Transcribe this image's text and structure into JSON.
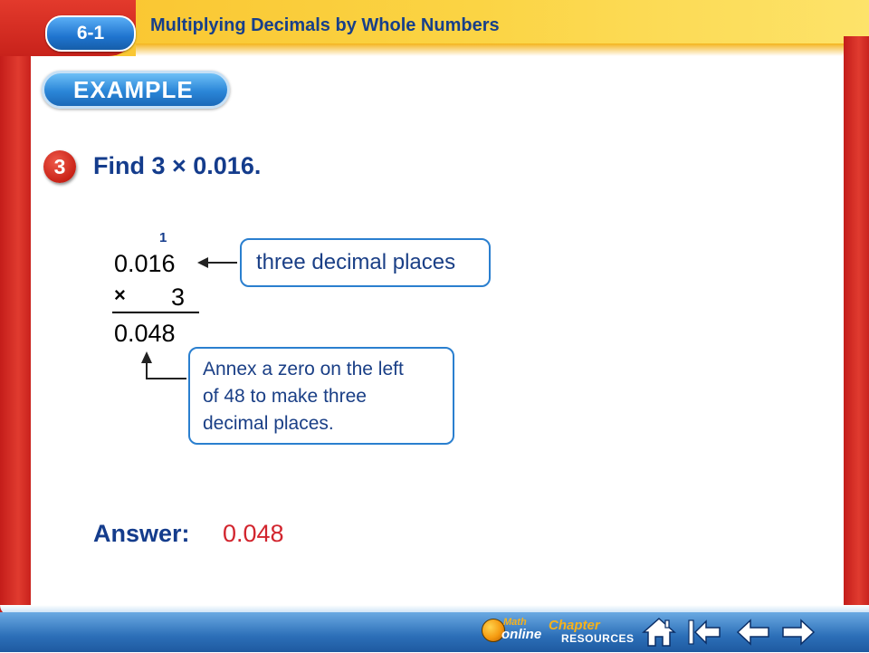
{
  "header": {
    "lesson_number": "6-1",
    "lesson_title": "Multiplying Decimals by Whole Numbers"
  },
  "example_banner": "EXAMPLE",
  "step": {
    "number": "3",
    "prompt": "Find 3 × 0.016."
  },
  "arithmetic": {
    "carry": "1",
    "factor_top": "0.016",
    "operator": "×",
    "factor_bottom": "3",
    "product": "0.048"
  },
  "callouts": {
    "decimal_places": "three decimal places",
    "annex_zero_lines": [
      "Annex a zero on the left",
      "of 48 to make three",
      "decimal places."
    ]
  },
  "answer": {
    "label": "Answer:",
    "value": "0.048"
  },
  "nav": {
    "math_online_top": "Math",
    "math_online_bottom": "online",
    "chapter_resources_top": "Chapter",
    "chapter_resources_bottom": "RESOURCES",
    "icons": [
      "home-icon",
      "first-slide-icon",
      "previous-icon",
      "next-icon"
    ]
  },
  "colors": {
    "heading_blue": "#143c8c",
    "answer_red": "#d2252e",
    "callout_border": "#2a7fcf",
    "frame_red": "#c9221d",
    "banner_yellow": "#fbd444"
  }
}
